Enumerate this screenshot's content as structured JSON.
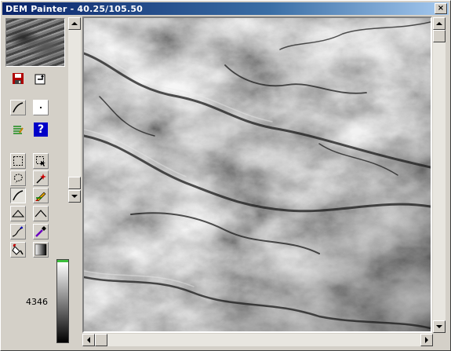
{
  "window": {
    "title": "DEM Painter - 40.25/105.50",
    "close_glyph": "×"
  },
  "toolbar": {
    "file": [
      {
        "name": "save-icon",
        "icon": "floppy-disk"
      },
      {
        "name": "export-icon",
        "icon": "export-arrow"
      }
    ],
    "view": [
      {
        "name": "profile-line-icon",
        "icon": "line-curve"
      },
      {
        "name": "point-icon",
        "icon": "point"
      }
    ],
    "info": [
      {
        "name": "notes-icon",
        "icon": "notes-lines"
      },
      {
        "name": "help-icon",
        "icon": "question-mark",
        "glyph": "?"
      }
    ],
    "tools": [
      {
        "name": "rect-select-tool",
        "icon": "rect-select"
      },
      {
        "name": "select-arrow-tool",
        "icon": "select-arrow"
      },
      {
        "name": "lasso-tool",
        "icon": "lasso"
      },
      {
        "name": "magic-wand-tool",
        "icon": "magic-wand"
      },
      {
        "name": "draw-line-tool",
        "icon": "line-curve",
        "active": true
      },
      {
        "name": "pencil-tool",
        "icon": "pencil"
      },
      {
        "name": "raise-tool",
        "icon": "raise-triangle"
      },
      {
        "name": "lower-tool",
        "icon": "lower-chevron"
      },
      {
        "name": "smooth-tool",
        "icon": "smooth-curve"
      },
      {
        "name": "eyedropper-tool",
        "icon": "eyedropper"
      },
      {
        "name": "fill-tool",
        "icon": "paint-bucket"
      },
      {
        "name": "gradient-tool",
        "icon": "gradient"
      }
    ]
  },
  "elevation": {
    "value": "4346",
    "colors": {
      "top_marker": "#3cbf3c",
      "high": "#ffffff",
      "low": "#000000"
    }
  },
  "colors": {
    "titlebar_start": "#0a246a",
    "titlebar_end": "#a6caf0",
    "face": "#d4d0c8",
    "help_blue": "#0000c8"
  },
  "scroll": {
    "left_vertical_position": 0.9,
    "right_vertical_position": 0.0,
    "horizontal_position": 0.0
  }
}
